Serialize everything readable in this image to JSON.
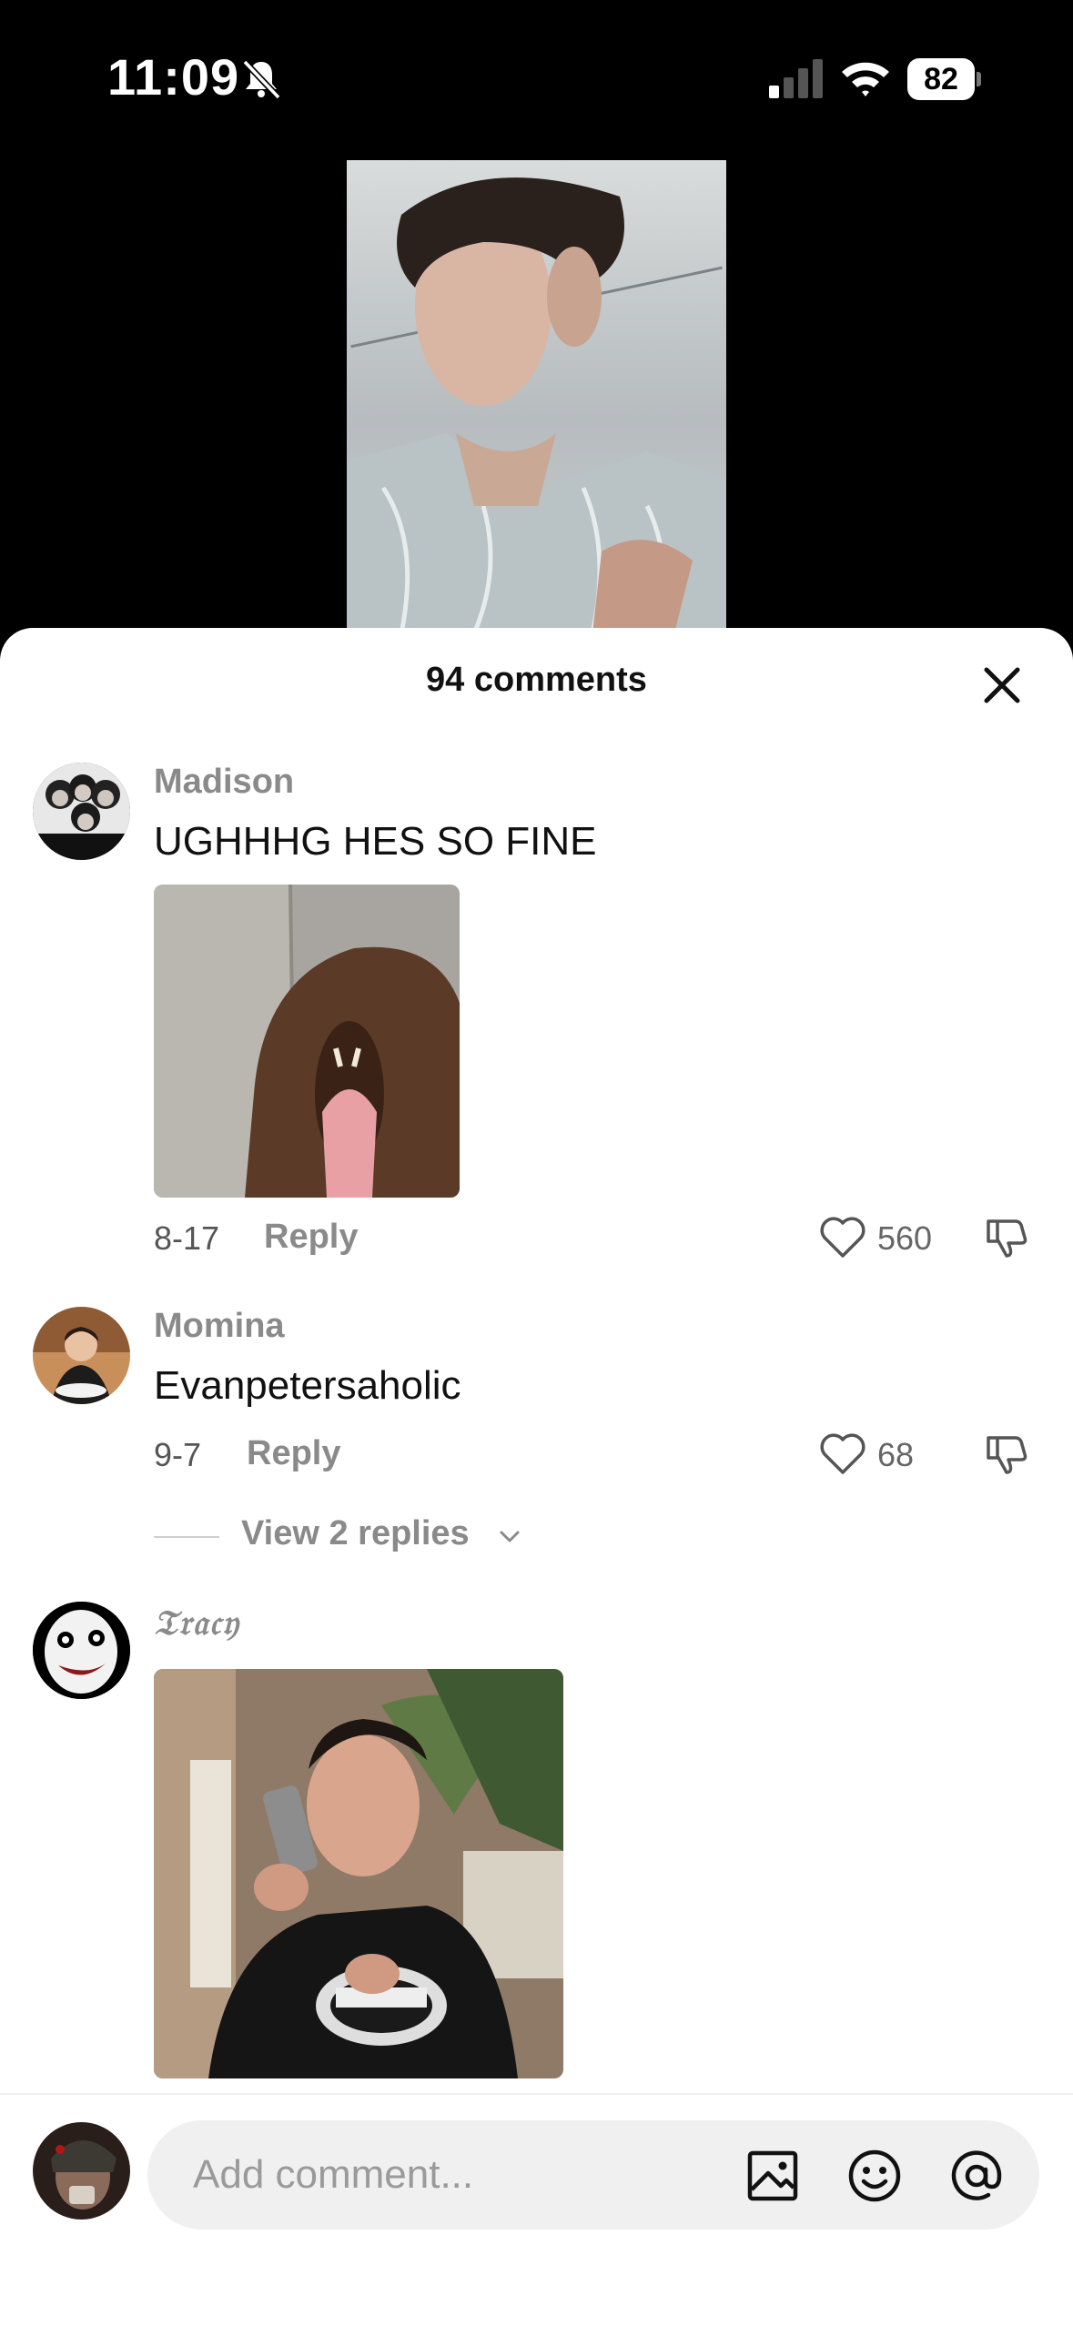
{
  "status_bar": {
    "time": "11:09",
    "battery": "82"
  },
  "sheet": {
    "title": "94 comments"
  },
  "comments": [
    {
      "username": "Madison",
      "text": "UGHHHG HES SO FINE",
      "date": "8-17",
      "reply_label": "Reply",
      "likes": "560"
    },
    {
      "username": "Momina",
      "text": "Evanpetersaholic",
      "date": "9-7",
      "reply_label": "Reply",
      "likes": "68",
      "view_replies": "View 2 replies"
    },
    {
      "username": "𝔗𝔯𝔞𝔠𝔶"
    }
  ],
  "input": {
    "placeholder": "Add comment..."
  },
  "icons": {
    "bell": "bell-slash-icon",
    "signal": "cellular-signal-icon",
    "wifi": "wifi-icon",
    "close": "close-icon",
    "like": "heart-outline-icon",
    "dislike": "thumbs-down-icon",
    "image": "image-icon",
    "emoji": "emoji-icon",
    "mention": "at-sign-icon"
  },
  "colors": {
    "background": "#000000",
    "sheet": "#ffffff",
    "muted_text": "#8a8a8a",
    "field": "#f0f0f0"
  }
}
